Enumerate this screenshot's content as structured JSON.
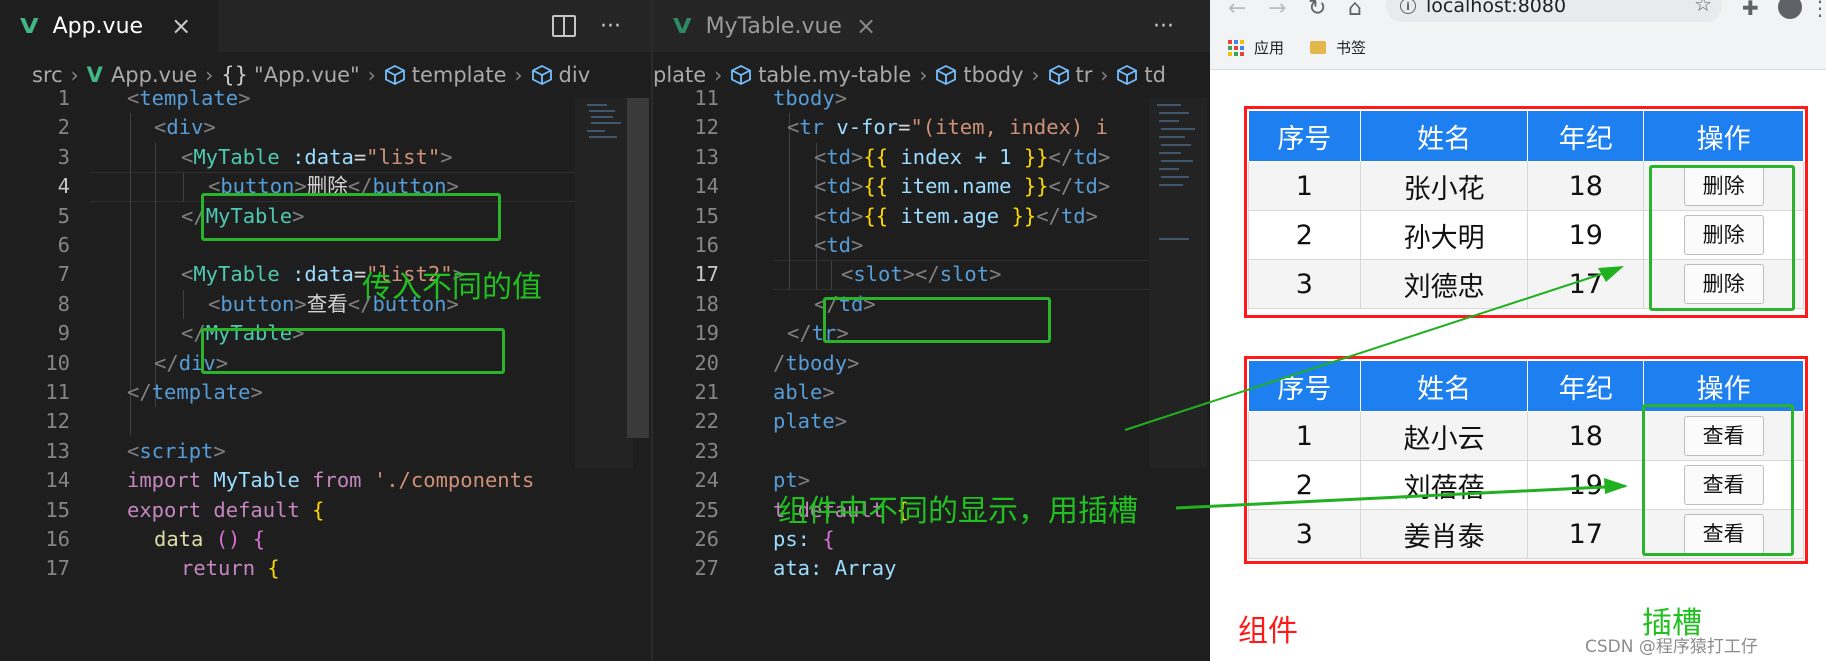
{
  "left_editor": {
    "tab": {
      "label": "App.vue",
      "close": "×"
    },
    "actions": {
      "more": "···"
    },
    "breadcrumb": [
      "src",
      "App.vue",
      "\"App.vue\"",
      "template",
      "div"
    ],
    "lines": [
      "1",
      "2",
      "3",
      "4",
      "5",
      "6",
      "7",
      "8",
      "9",
      "10",
      "11",
      "12",
      "13",
      "14",
      "15",
      "16",
      "17"
    ],
    "code": {
      "l1": "template",
      "l2": "div",
      "l3_comp": "MyTable",
      "l3_attr": ":data",
      "l3_val": "\"list\"",
      "l4_tag": "button",
      "l4_text": "删除",
      "l4_close": "button",
      "l5": "MyTable",
      "l7_comp": "MyTable",
      "l7_attr": ":data",
      "l7_val": "\"list2\"",
      "l8_tag": "button",
      "l8_text": "查看",
      "l8_close": "button",
      "l9": "MyTable",
      "l10": "div",
      "l11": "template",
      "l13": "script",
      "l14_kw": "import",
      "l14_name": "MyTable",
      "l14_from": "from",
      "l14_path": "'./components",
      "l15_kw": "export",
      "l15_def": "default",
      "l16": "data",
      "l17": "return"
    }
  },
  "right_editor": {
    "tab": {
      "label": "MyTable.vue",
      "close": "×"
    },
    "actions": {
      "more": "···"
    },
    "breadcrumb": [
      "plate",
      "table.my-table",
      "tbody",
      "tr",
      "td"
    ],
    "lines": [
      "11",
      "12",
      "13",
      "14",
      "15",
      "16",
      "17",
      "18",
      "19",
      "20",
      "21",
      "22",
      "23",
      "24",
      "25",
      "26",
      "27"
    ],
    "code": {
      "l11": "tbody",
      "l12_tag": "tr",
      "l12_attr": "v-for",
      "l12_val": "\"(item, index) i",
      "l13_expr": "index + 1",
      "l14_expr": "item.name",
      "l15_expr": "item.age",
      "l16": "td",
      "l17": "slot",
      "l18": "td",
      "l19": "tr",
      "l20": "tbody",
      "l21": "able",
      "l22": "plate",
      "l24": "pt",
      "l25": "t default",
      "l26": "ps:",
      "l27": "ata: Array"
    }
  },
  "annotations": {
    "pass_values": "传入不同的值",
    "slot_note": "组件中不同的显示，用插槽",
    "component": "组件",
    "slot": "插槽"
  },
  "browser": {
    "url": "localhost:8080",
    "bookmarks": [
      "应用",
      "书签"
    ],
    "table_headers": [
      "序号",
      "姓名",
      "年纪",
      "操作"
    ],
    "table1": [
      {
        "index": "1",
        "name": "张小花",
        "age": "18",
        "action": "删除"
      },
      {
        "index": "2",
        "name": "孙大明",
        "age": "19",
        "action": "删除"
      },
      {
        "index": "3",
        "name": "刘德忠",
        "age": "17",
        "action": "删除"
      }
    ],
    "table2": [
      {
        "index": "1",
        "name": "赵小云",
        "age": "18",
        "action": "查看"
      },
      {
        "index": "2",
        "name": "刘蓓蓓",
        "age": "19",
        "action": "查看"
      },
      {
        "index": "3",
        "name": "姜肖泰",
        "age": "17",
        "action": "查看"
      }
    ]
  },
  "watermark": "CSDN @程序猿打工仔",
  "colors": {
    "vue_green": "#41b883",
    "table_header": "#1e7ff0",
    "annotation_red": "#ff1a1a",
    "annotation_green": "#2bb32b"
  }
}
